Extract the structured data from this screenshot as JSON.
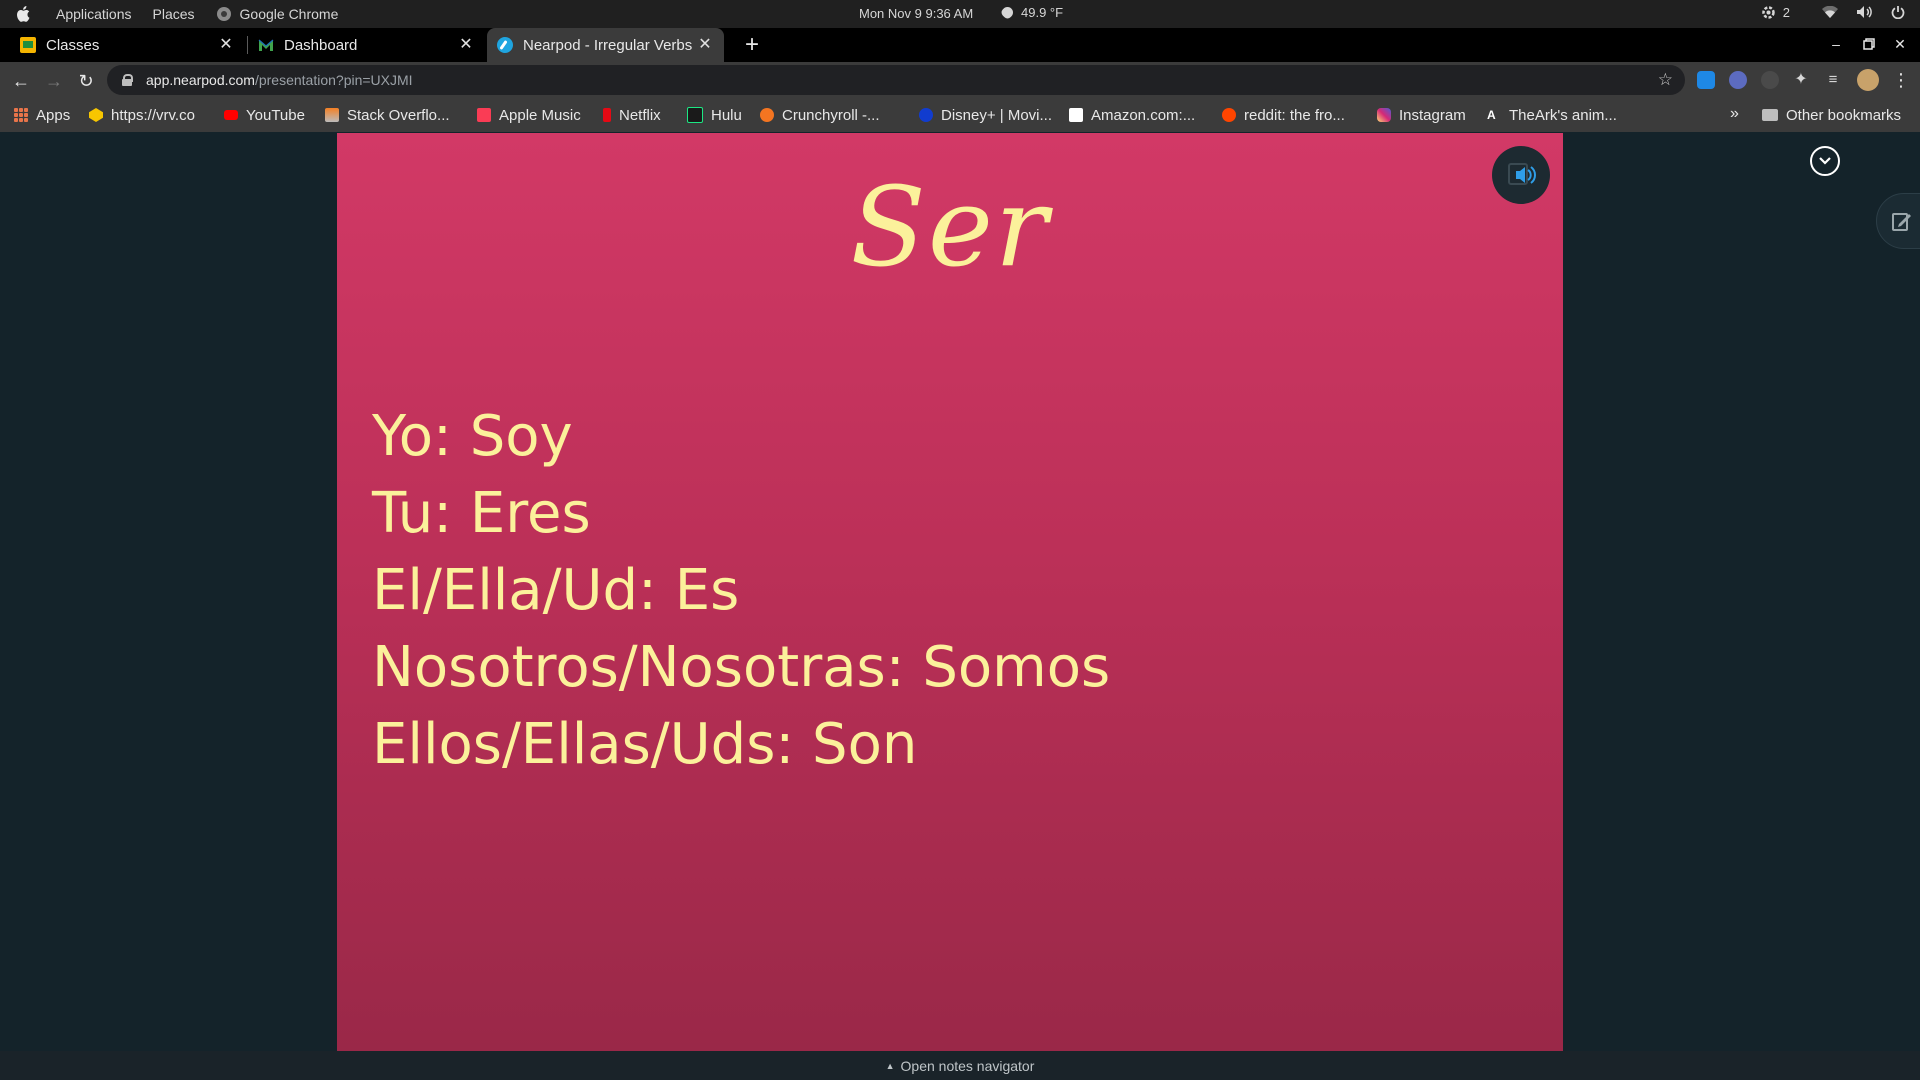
{
  "system_bar": {
    "menu": [
      "Applications",
      "Places",
      "Google Chrome"
    ],
    "datetime": "Mon Nov 9   9:36 AM",
    "weather": "49.9 °F",
    "notification_count": "2"
  },
  "tabs": [
    {
      "label": "Classes",
      "favicon_color": "#f4b400",
      "active": false
    },
    {
      "label": "Dashboard",
      "favicon_color": "#2e7d32",
      "active": false
    },
    {
      "label": "Nearpod - Irregular Verbs",
      "favicon_color": "#1fa5e0",
      "active": true
    }
  ],
  "address_bar": {
    "domain": "app.nearpod.com",
    "path": "/presentation?pin=UXJMI"
  },
  "bookmarks": [
    {
      "label": "Apps",
      "icon": "apps-grid-icon"
    },
    {
      "label": "https://vrv.co",
      "icon": "vrv-icon",
      "color": "#f7c600"
    },
    {
      "label": "YouTube",
      "icon": "youtube-icon",
      "color": "#ff0000"
    },
    {
      "label": "Stack Overflo...",
      "icon": "stackoverflow-icon",
      "color": "#f48024"
    },
    {
      "label": "Apple Music",
      "icon": "apple-music-icon",
      "color": "#fa3c55"
    },
    {
      "label": "Netflix",
      "icon": "netflix-icon",
      "color": "#e50914"
    },
    {
      "label": "Hulu",
      "icon": "hulu-icon",
      "color": "#1ce783"
    },
    {
      "label": "Crunchyroll -...",
      "icon": "crunchyroll-icon",
      "color": "#f47521"
    },
    {
      "label": "Disney+ | Movi...",
      "icon": "disney-icon",
      "color": "#113ccf"
    },
    {
      "label": "Amazon.com:...",
      "icon": "amazon-icon",
      "color": "#ffffff"
    },
    {
      "label": "reddit: the fro...",
      "icon": "reddit-icon",
      "color": "#ff4500"
    },
    {
      "label": "Instagram",
      "icon": "instagram-icon",
      "color": "#d6249f"
    },
    {
      "label": "TheArk's anim...",
      "icon": "theark-icon",
      "color": "#ffffff"
    }
  ],
  "other_bookmarks": "Other bookmarks",
  "slide": {
    "title": "Ser",
    "conjugations": [
      "Yo: Soy",
      "Tu: Eres",
      "El/Ella/Ud: Es",
      "Nosotros/Nosotras: Somos",
      "Ellos/Ellas/Uds: Son"
    ]
  },
  "footer": {
    "notes_label": "Open notes navigator"
  },
  "colors": {
    "slide_text": "#fbf19b",
    "slide_bg": "#c4345d",
    "page_bg": "#14232a"
  }
}
